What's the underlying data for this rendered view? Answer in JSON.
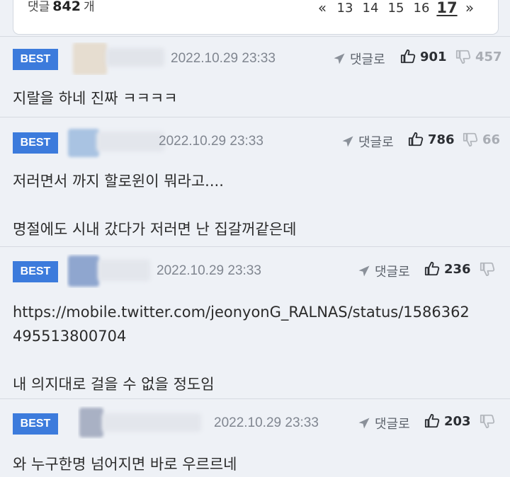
{
  "header": {
    "comments_label": "댓글",
    "comments_count": "842",
    "comments_unit": "개",
    "pagination": {
      "prev": "«",
      "pages": [
        "13",
        "14",
        "15",
        "16",
        "17"
      ],
      "current": "17",
      "next": "»"
    }
  },
  "comments": [
    {
      "badge": "BEST",
      "date": "2022.10.29 23:33",
      "reply_label": "댓글로",
      "likes": "901",
      "dislikes": "457",
      "text": "지랄을 하네 진짜 ㅋㅋㅋㅋ"
    },
    {
      "badge": "BEST",
      "date": "2022.10.29 23:33",
      "reply_label": "댓글로",
      "likes": "786",
      "dislikes": "66",
      "text": "저러면서 까지 할로윈이 뭐라고....\n\n명절에도 시내 갔다가 저러면 난 집갈꺼같은데"
    },
    {
      "badge": "BEST",
      "date": "2022.10.29 23:33",
      "reply_label": "댓글로",
      "likes": "236",
      "dislikes": "",
      "text": "https://mobile.twitter.com/jeonyonG_RALNAS/status/1586362\n495513800704\n\n내 의지대로 걸을 수 없을 정도임"
    },
    {
      "badge": "BEST",
      "date": "2022.10.29 23:33",
      "reply_label": "댓글로",
      "likes": "203",
      "dislikes": "",
      "text": "와 누구한명 넘어지면 바로 우르르네"
    }
  ],
  "icons": {
    "reply": "send-arrow-icon",
    "like": "thumbs-up-icon",
    "dislike": "thumbs-down-icon"
  },
  "colors": {
    "badge": "#3c7bdc",
    "background": "#eef1f6",
    "date": "#808690"
  }
}
